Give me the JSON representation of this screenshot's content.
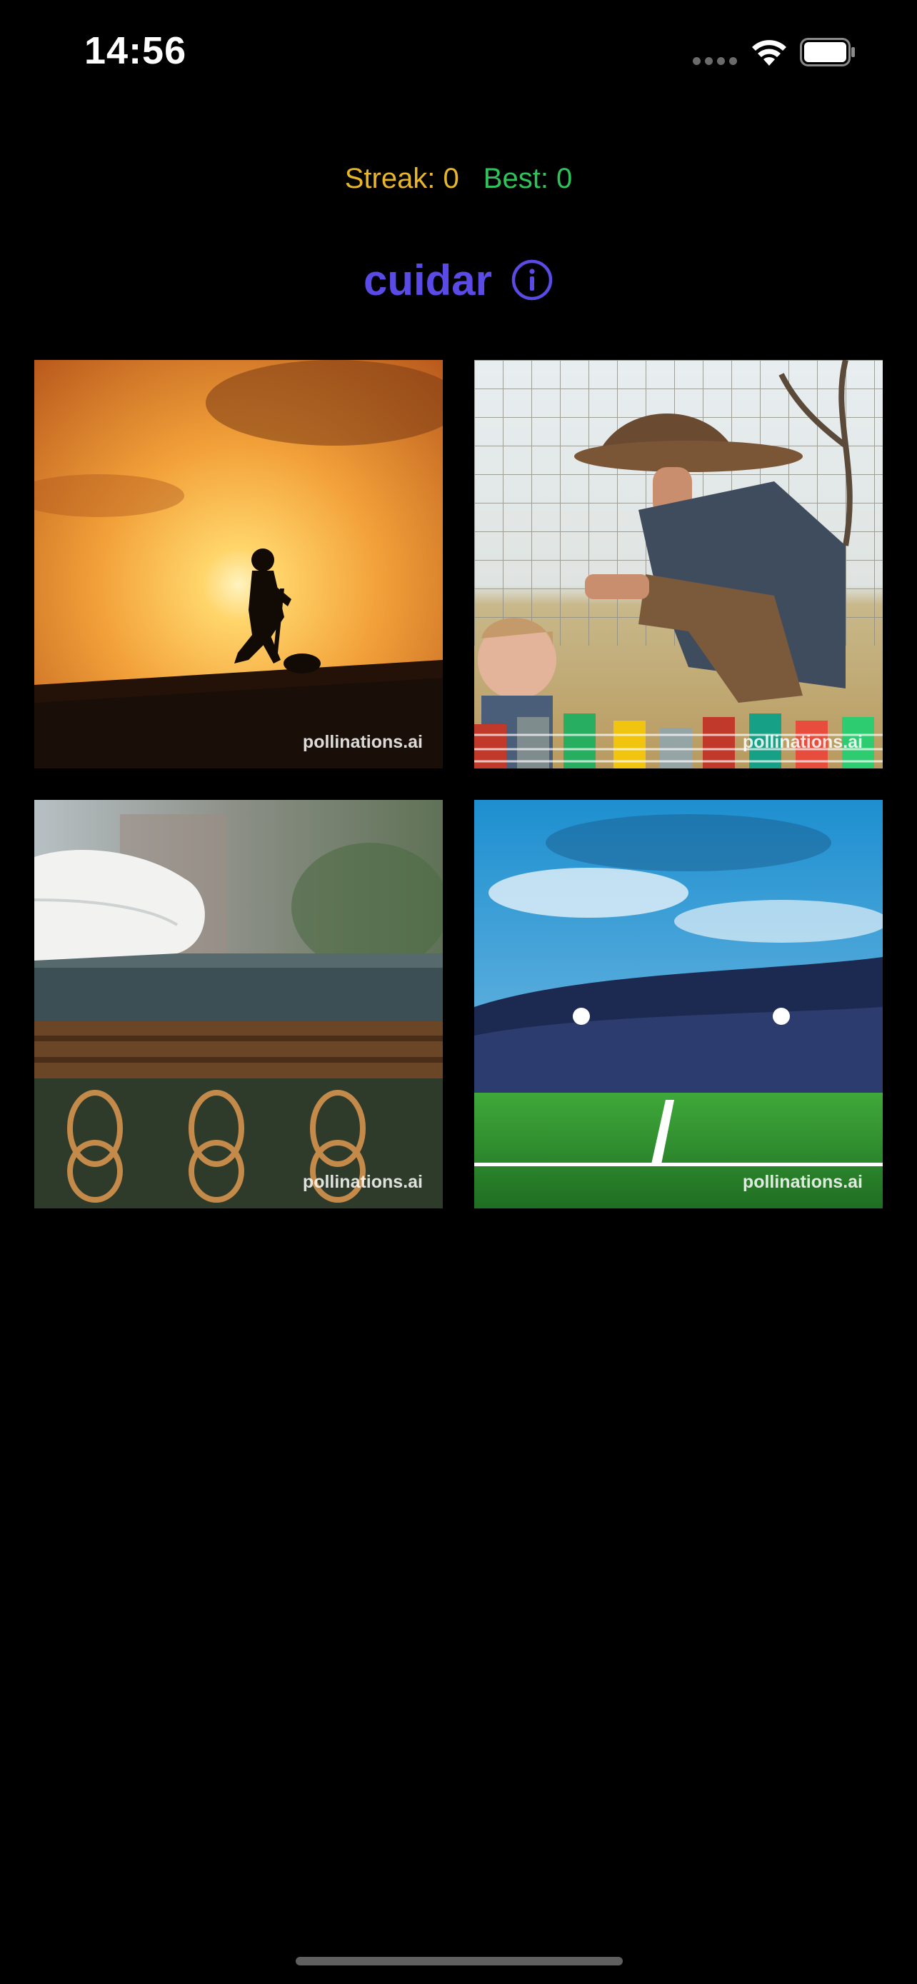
{
  "status_bar": {
    "time": "14:56",
    "signal_icon": "cellular-signal-icon",
    "wifi_icon": "wifi-icon",
    "battery_icon": "battery-icon"
  },
  "scores": {
    "streak_label": "Streak: 0",
    "best_label": "Best: 0"
  },
  "quiz": {
    "word": "cuidar",
    "info_icon": "info-icon",
    "accent_color": "#5b4be6"
  },
  "images": [
    {
      "id": "option-1",
      "subject": "silhouette of a man working on a roof at sunset",
      "watermark": "pollinations.ai"
    },
    {
      "id": "option-2",
      "subject": "old man in a hat crouching near a child and stacks of poker chips",
      "watermark": "pollinations.ai"
    },
    {
      "id": "option-3",
      "subject": "folded white towel on a wooden railing",
      "watermark": "pollinations.ai"
    },
    {
      "id": "option-4",
      "subject": "football stadium with green pitch under blue sky",
      "watermark": "pollinations.ai"
    }
  ],
  "colors": {
    "background": "#000000",
    "streak": "#e8b62a",
    "best": "#2fc45a"
  }
}
